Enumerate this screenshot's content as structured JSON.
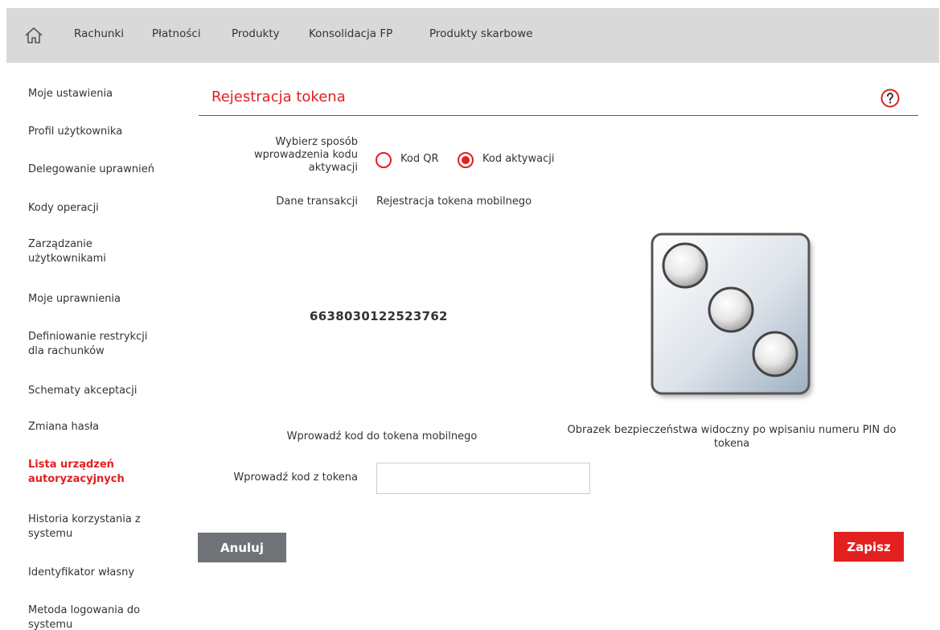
{
  "nav": {
    "home_icon": "home-icon",
    "items": [
      "Rachunki",
      "Płatności",
      "Produkty",
      "Konsolidacja FP",
      "Produkty skarbowe"
    ]
  },
  "sidebar": {
    "items": [
      "Moje ustawienia",
      "Profil użytkownika",
      "Delegowanie uprawnień",
      "Kody operacji",
      "Zarządzanie użytkownikami",
      "Moje uprawnienia",
      "Definiowanie restrykcji dla rachunków",
      "Schematy akceptacji",
      "Zmiana hasła",
      "Lista urządzeń autoryzacyjnych",
      "Historia korzystania z systemu",
      "Identyfikator własny",
      "Metoda logowania do systemu"
    ],
    "active_item": "Lista urządzeń autoryzacyjnych"
  },
  "page": {
    "title": "Rejestracja tokena",
    "help_icon": "help-icon"
  },
  "form": {
    "method_label": "Wybierz sposób wprowadzenia kodu aktywacji",
    "option_qr": "Kod QR",
    "option_code": "Kod aktywacji",
    "selected_option": "Kod aktywacji",
    "transaction_label": "Dane transakcji",
    "transaction_value": "Rejestracja tokena mobilnego",
    "activation_code": "6638030122523762",
    "enter_code_caption": "Wprowadź kod do tokena mobilnego",
    "security_image_caption": "Obrazek bezpieczeństwa widoczny po wpisaniu numeru PIN do tokena",
    "token_input_label": "Wprowadź kod z tokena",
    "token_input_value": ""
  },
  "buttons": {
    "cancel": "Anuluj",
    "save": "Zapisz"
  },
  "colors": {
    "accent": "#e1201f",
    "topbar": "#d9d9d9",
    "cancel_button": "#6f7377"
  }
}
